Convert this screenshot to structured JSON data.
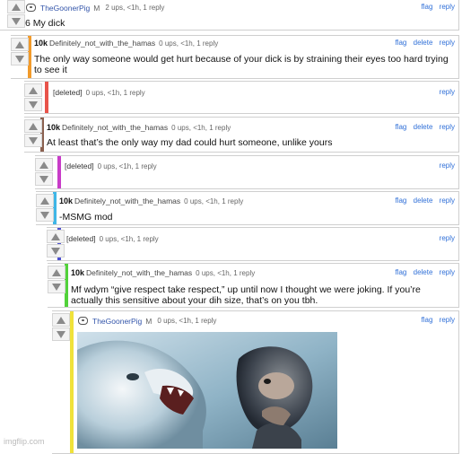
{
  "colors": {
    "link": "#3070d8",
    "orange": "#f29b2b",
    "red": "#e8534a",
    "brown": "#8b6150",
    "magenta": "#c83cc8",
    "cyan": "#3fb6e6",
    "blue": "#4c4fd0",
    "green": "#52d23a",
    "yellow": "#f0e23a"
  },
  "actions": {
    "flag": "flag",
    "reply": "reply",
    "delete": "delete"
  },
  "comments": [
    {
      "user": "TheGoonerPig",
      "mod": "M",
      "meta": "2 ups, <1h, 1 reply",
      "text": "6 My dick"
    },
    {
      "rank": "10k",
      "user": "Definitely_not_with_the_hamas",
      "meta": "0 ups, <1h, 1 reply",
      "text": "The only way someone would get hurt because of your dick is by straining their eyes too hard trying to see it"
    },
    {
      "user": "[deleted]",
      "meta": "0 ups, <1h, 1 reply"
    },
    {
      "rank": "10k",
      "user": "Definitely_not_with_the_hamas",
      "meta": "0 ups, <1h, 1 reply",
      "text": "At least that’s the only way my dad could hurt someone, unlike yours"
    },
    {
      "user": "[deleted]",
      "meta": "0 ups, <1h, 1 reply"
    },
    {
      "rank": "10k",
      "user": "Definitely_not_with_the_hamas",
      "meta": "0 ups, <1h, 1 reply",
      "text": "-MSMG mod"
    },
    {
      "user": "[deleted]",
      "meta": "0 ups, <1h, 1 reply"
    },
    {
      "rank": "10k",
      "user": "Definitely_not_with_the_hamas",
      "meta": "0 ups, <1h, 1 reply",
      "text": "Mf wdym “give respect take respect,” up until now I thought we were joking. If you’re actually this sensitive about your dih size, that’s on you tbh."
    },
    {
      "user": "TheGoonerPig",
      "mod": "M",
      "meta": "0 ups, <1h, 1 reply"
    }
  ],
  "watermark": "imgflip.com"
}
